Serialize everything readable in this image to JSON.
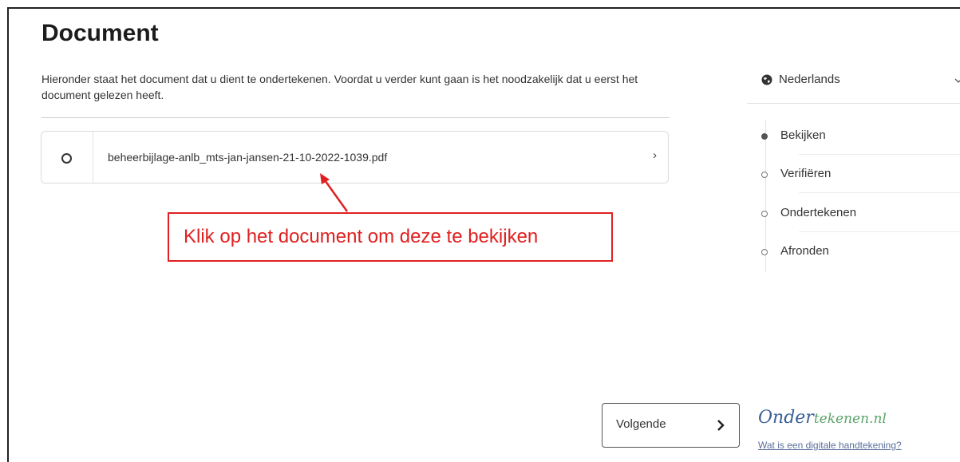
{
  "page": {
    "title": "Document",
    "intro_text": "Hieronder staat het document dat u dient te ondertekenen. Voordat u verder kunt gaan is het noodzakelijk dat u eerst het document gelezen heeft."
  },
  "document": {
    "filename": "beheerbijlage-anlb_mts-jan-jansen-21-10-2022-1039.pdf",
    "chevron": "›"
  },
  "annotation": {
    "text": "Klik op het document om deze te bekijken",
    "color": "#e02020"
  },
  "language": {
    "selected": "Nederlands",
    "icon": "globe-icon"
  },
  "steps": [
    {
      "label": "Bekijken",
      "active": true
    },
    {
      "label": "Verifiëren",
      "active": false
    },
    {
      "label": "Ondertekenen",
      "active": false
    },
    {
      "label": "Afronden",
      "active": false
    }
  ],
  "footer": {
    "next_label": "Volgende",
    "brand_part1": "Onder",
    "brand_part2": "tekenen.nl",
    "help_link": "Wat is een digitale handtekening?"
  }
}
